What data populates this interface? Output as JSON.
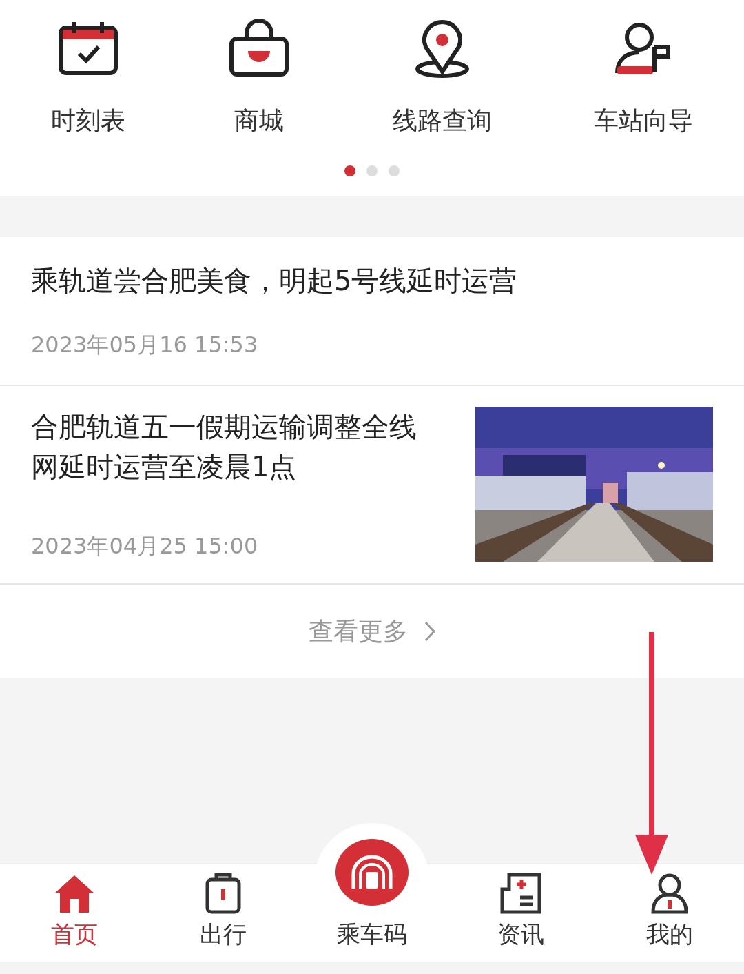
{
  "shortcuts": [
    {
      "label": "时刻表"
    },
    {
      "label": "商城"
    },
    {
      "label": "线路查询"
    },
    {
      "label": "车站向导"
    }
  ],
  "pager": [
    {
      "selected": true
    },
    {
      "selected": false
    },
    {
      "selected": false
    }
  ],
  "news": [
    {
      "kind": "text",
      "title": "乘轨道尝合肥美食，明起5号线延时运营",
      "time": "2023年05月16 15:53"
    },
    {
      "kind": "with_picture",
      "title": "合肥轨道五一假期运输调整全线网延时运营至凌晨1点",
      "time": "2023年04月25 15:00"
    }
  ],
  "more": {
    "label": "查看更多"
  },
  "nav": [
    {
      "kind": "tab",
      "label": "首页",
      "selected": true
    },
    {
      "kind": "tab",
      "label": "出行",
      "selected": false
    },
    {
      "kind": "center",
      "label": "乘车码",
      "selected": false
    },
    {
      "kind": "tab",
      "label": "资讯",
      "selected": false
    },
    {
      "kind": "tab",
      "label": "我的",
      "selected": false
    }
  ]
}
